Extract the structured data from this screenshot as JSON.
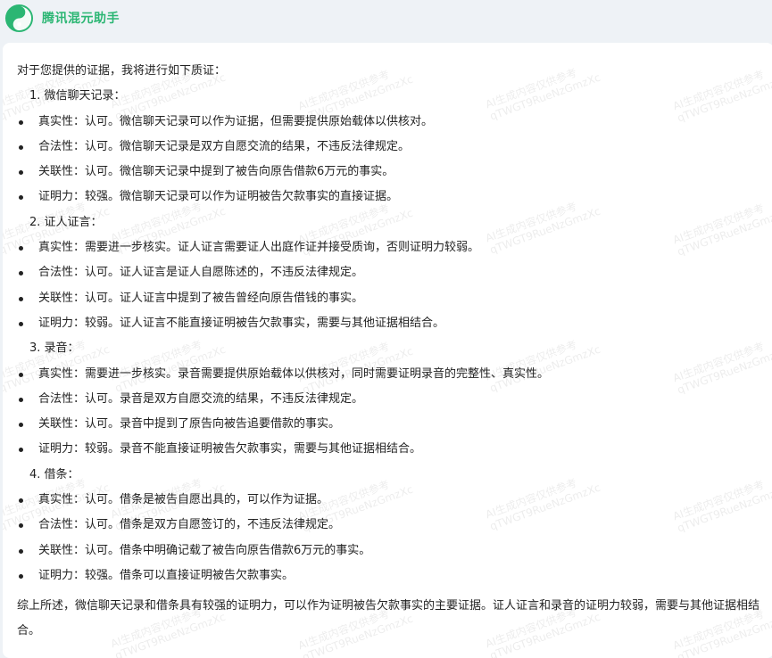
{
  "header": {
    "app_title": "腾讯混元助手"
  },
  "content": {
    "intro": "对于您提供的证据，我将进行如下质证：",
    "sections": [
      {
        "heading": "1. 微信聊天记录：",
        "items": [
          "真实性：认可。微信聊天记录可以作为证据，但需要提供原始载体以供核对。",
          "合法性：认可。微信聊天记录是双方自愿交流的结果，不违反法律规定。",
          "关联性：认可。微信聊天记录中提到了被告向原告借款6万元的事实。",
          "证明力：较强。微信聊天记录可以作为证明被告欠款事实的直接证据。"
        ]
      },
      {
        "heading": "2. 证人证言：",
        "items": [
          "真实性：需要进一步核实。证人证言需要证人出庭作证并接受质询，否则证明力较弱。",
          "合法性：认可。证人证言是证人自愿陈述的，不违反法律规定。",
          "关联性：认可。证人证言中提到了被告曾经向原告借钱的事实。",
          "证明力：较弱。证人证言不能直接证明被告欠款事实，需要与其他证据相结合。"
        ]
      },
      {
        "heading": "3. 录音：",
        "items": [
          "真实性：需要进一步核实。录音需要提供原始载体以供核对，同时需要证明录音的完整性、真实性。",
          "合法性：认可。录音是双方自愿交流的结果，不违反法律规定。",
          "关联性：认可。录音中提到了原告向被告追要借款的事实。",
          "证明力：较弱。录音不能直接证明被告欠款事实，需要与其他证据相结合。"
        ]
      },
      {
        "heading": "4. 借条：",
        "items": [
          "真实性：认可。借条是被告自愿出具的，可以作为证据。",
          "合法性：认可。借条是双方自愿签订的，不违反法律规定。",
          "关联性：认可。借条中明确记载了被告向原告借款6万元的事实。",
          "证明力：较强。借条可以直接证明被告欠款事实。"
        ]
      }
    ],
    "summary": "综上所述，微信聊天记录和借条具有较强的证明力，可以作为证明被告欠款事实的主要证据。证人证言和录音的证明力较弱，需要与其他证据相结合。"
  },
  "watermark": {
    "line1": "AI生成内容仅供参考",
    "line2": "qTWGT9RueNzGmzXc"
  },
  "colors": {
    "brand": "#2bb673",
    "background": "#eef2f6",
    "card": "#ffffff"
  },
  "icons": {
    "logo": "hunyuan-logo-icon"
  }
}
